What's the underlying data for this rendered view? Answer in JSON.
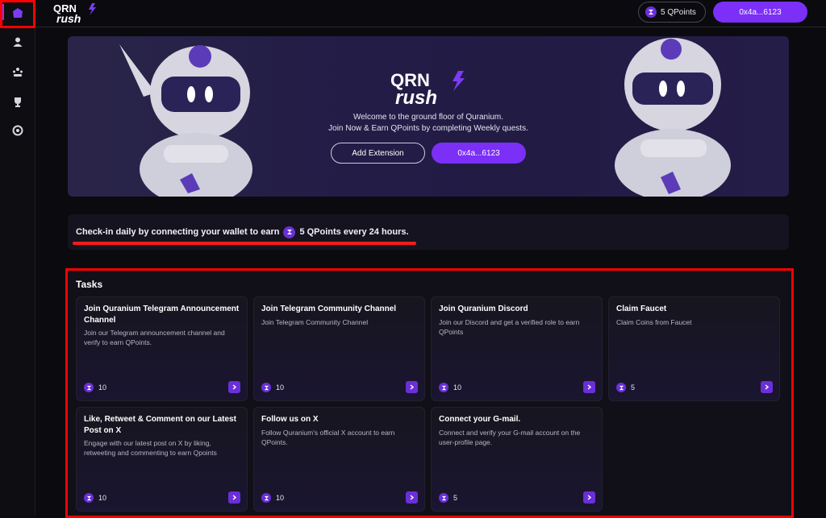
{
  "app": {
    "name": "QRN rush"
  },
  "sidebar": {
    "items": [
      {
        "icon": "home-icon",
        "active": true
      },
      {
        "icon": "user-icon",
        "active": false
      },
      {
        "icon": "community-icon",
        "active": false
      },
      {
        "icon": "trophy-icon",
        "active": false
      },
      {
        "icon": "settings-icon",
        "active": false
      }
    ]
  },
  "header": {
    "points_label": "5 QPoints",
    "wallet_label": "0x4a...6123"
  },
  "hero": {
    "logo_text": "QRN rush",
    "line1": "Welcome to the ground floor of Quranium.",
    "line2": "Join Now & Earn QPoints by completing Weekly quests.",
    "add_extension_label": "Add Extension",
    "wallet_label": "0x4a...6123"
  },
  "checkin": {
    "prefix": "Check-in daily by connecting your wallet to earn",
    "suffix": "5 QPoints every 24 hours."
  },
  "tasks": {
    "title": "Tasks",
    "items": [
      {
        "title": "Join Quranium Telegram Announcement Channel",
        "desc": "Join our Telegram announcement channel and verify to earn QPoints.",
        "points": "10"
      },
      {
        "title": "Join Telegram Community Channel",
        "desc": "Join Telegram Community Channel",
        "points": "10"
      },
      {
        "title": "Join Quranium Discord",
        "desc": "Join our Discord and get a verified role to earn QPoints",
        "points": "10"
      },
      {
        "title": "Claim Faucet",
        "desc": "Claim Coins from Faucet",
        "points": "5"
      },
      {
        "title": "Like, Retweet & Comment on our Latest Post on X",
        "desc": "Engage with our latest post on X by liking, retweeting and commenting to earn Qpoints",
        "points": "10"
      },
      {
        "title": "Follow us on X",
        "desc": "Follow Quranium's official X account to earn QPoints.",
        "points": "10"
      },
      {
        "title": "Connect your G-mail.",
        "desc": "Connect and verify your G-mail account on the user-profile page.",
        "points": "5"
      }
    ]
  },
  "colors": {
    "accent": "#7b2ff7",
    "highlight": "#ff0000",
    "background": "#0b0a0e"
  }
}
